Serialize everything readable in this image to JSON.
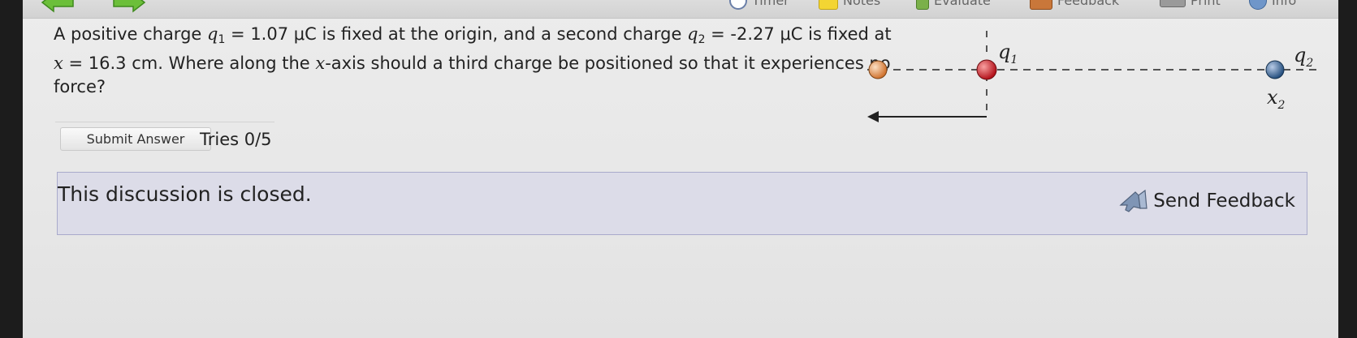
{
  "toolbar": {
    "items": [
      {
        "label": "Timer",
        "icon": "clock-icon"
      },
      {
        "label": "Notes",
        "icon": "notes-icon"
      },
      {
        "label": "Evaluate",
        "icon": "evaluate-icon"
      },
      {
        "label": "Feedback",
        "icon": "feedback-icon"
      },
      {
        "label": "Print",
        "icon": "printer-icon"
      },
      {
        "label": "Info",
        "icon": "info-icon"
      }
    ]
  },
  "question": {
    "t1": "A positive charge ",
    "q1_sym": "q",
    "q1_sub": "1",
    "t2": " = 1.07 μC is fixed at the origin, and a second charge ",
    "q2_sym": "q",
    "q2_sub": "2",
    "t3": " = -2.27 μC is fixed at ",
    "x_sym": "x",
    "t4": " = 16.3 cm. Where along the ",
    "x_sym2": "x",
    "t5": "-axis should a third charge be positioned so that it experiences no force?"
  },
  "submit": {
    "label": "Submit Answer"
  },
  "tries": "Tries 0/5",
  "diagram": {
    "q1_label": "q",
    "q1_sub": "1",
    "q2_label": "q",
    "q2_sub": "2",
    "x2_label": "x",
    "x2_sub": "2"
  },
  "discussion": {
    "text": "This discussion is closed.",
    "feedback_label": "Send Feedback"
  },
  "colors": {
    "q1_charge": "#d0232a",
    "q2_charge": "#2f5d8f",
    "third_charge": "#e0894b",
    "discussion_bg": "#dcdce8"
  }
}
